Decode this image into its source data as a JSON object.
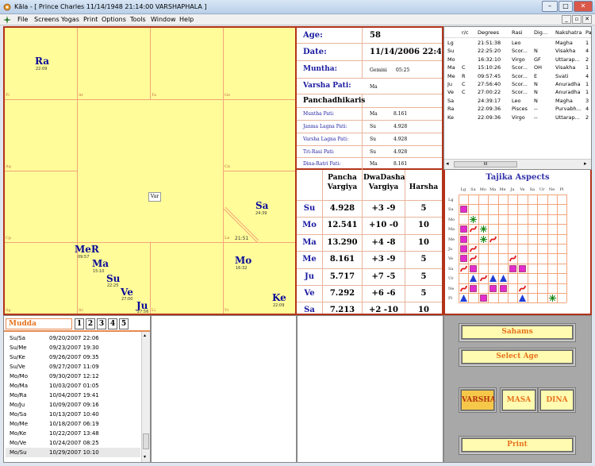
{
  "window": {
    "title": "Kāla - [ Prince Charles  11/14/1948  21:14:00      VARSHAPHALA ]",
    "min": "–",
    "max": "□",
    "close": "✕"
  },
  "menu": [
    "File",
    "Screens",
    "Yogas",
    "Print",
    "Options",
    "Tools",
    "Window",
    "Help"
  ],
  "mdi": {
    "min": "_",
    "restore": "▫",
    "close": "✕"
  },
  "chart": {
    "grid_labels": [
      "Pi",
      "Ar",
      "Ta",
      "Ge",
      "Aq",
      "Cn",
      "Cp",
      "Le",
      "Sg",
      "Sc",
      "Li",
      "Vi"
    ],
    "lagna_time": "21:51",
    "center_label": "Var",
    "planets": [
      {
        "name": "Ra",
        "time": "22:09"
      },
      {
        "name": "Sa",
        "time": "24:39"
      },
      {
        "name": "MeR",
        "time": "09:57"
      },
      {
        "name": "Ma",
        "time": "15:10"
      },
      {
        "name": "Su",
        "time": "22:25"
      },
      {
        "name": "Ve",
        "time": "27:00"
      },
      {
        "name": "Ju",
        "time": "27:56"
      },
      {
        "name": "Mo",
        "time": "16:32"
      },
      {
        "name": "Ke",
        "time": "22:09"
      }
    ]
  },
  "info": {
    "age_label": "Age:",
    "age": "58",
    "date_label": "Date:",
    "date": "11/14/2006  22:47:29",
    "muntha_label": "Muntha:",
    "muntha_sign": "Gemini",
    "muntha_deg": "05:25",
    "varsha_pati_label": "Varsha Pati:",
    "varsha_pati": "Ma",
    "panchadhikaris_label": "Panchadhikaris",
    "rows": [
      {
        "label": "Muntha Pati:",
        "planet": "Ma",
        "value": "8.161"
      },
      {
        "label": "Janma Lagna Pati:",
        "planet": "Su",
        "value": "4.928"
      },
      {
        "label": "Varsha Lagna Pati:",
        "planet": "Su",
        "value": "4.928"
      },
      {
        "label": "Tri-Rasi Pati:",
        "planet": "Su",
        "value": "4.928"
      },
      {
        "label": "Dina-Ratri Pati:",
        "planet": "Ma",
        "value": "8.161"
      }
    ]
  },
  "vargiya": {
    "headers": [
      "Pancha Vargiya",
      "DwaDasha Vargiya",
      "Harsha"
    ],
    "rows": [
      {
        "p": "Su",
        "pancha": "4.928",
        "dwa": "+3  -9",
        "harsha": "5"
      },
      {
        "p": "Mo",
        "pancha": "12.541",
        "dwa": "+10  -0",
        "harsha": "10"
      },
      {
        "p": "Ma",
        "pancha": "13.290",
        "dwa": "+4  -8",
        "harsha": "10"
      },
      {
        "p": "Me",
        "pancha": "8.161",
        "dwa": "+3  -9",
        "harsha": "5"
      },
      {
        "p": "Ju",
        "pancha": "5.717",
        "dwa": "+7  -5",
        "harsha": "5"
      },
      {
        "p": "Ve",
        "pancha": "7.292",
        "dwa": "+6  -6",
        "harsha": "5"
      },
      {
        "p": "Sa",
        "pancha": "7.213",
        "dwa": "+2  -10",
        "harsha": "10"
      }
    ]
  },
  "positions": {
    "headers": [
      "",
      "r/c",
      "Degrees",
      "Rasi",
      "Dig...",
      "Nakshatra",
      "Pa"
    ],
    "rows": [
      [
        "Lg",
        "",
        "21:51:38",
        "Leo",
        "",
        "Magha",
        "1"
      ],
      [
        "Su",
        "",
        "22:25:20",
        "Scor...",
        "N",
        "Visakha",
        "4"
      ],
      [
        "Mo",
        "",
        "16:32:10",
        "Virgo",
        "GF",
        "Uttarap...",
        "2"
      ],
      [
        "Ma",
        "C",
        "15:10:26",
        "Scor...",
        "OH",
        "Visakha",
        "1"
      ],
      [
        "Me",
        "R",
        "09:57:45",
        "Scor...",
        "E",
        "Svati",
        "4"
      ],
      [
        "Ju",
        "C",
        "27:56:40",
        "Scor...",
        "N",
        "Anuradha",
        "1"
      ],
      [
        "Ve",
        "C",
        "27:00:22",
        "Scor...",
        "N",
        "Anuradha",
        "1"
      ],
      [
        "Sa",
        "",
        "24:39:17",
        "Leo",
        "N",
        "Magha",
        "3"
      ],
      [
        "Ra",
        "",
        "22:09:36",
        "Pisces",
        "--",
        "Purvabh...",
        "4"
      ],
      [
        "Ke",
        "",
        "22:09:36",
        "Virgo",
        "--",
        "Uttarap...",
        "2"
      ]
    ],
    "scroll_grip": "III"
  },
  "tajika": {
    "title": "Tajika Aspects",
    "cols": [
      "Lg",
      "Su",
      "Mo",
      "Ma",
      "Me",
      "Ju",
      "Ve",
      "Sa",
      "Ur",
      "Ne",
      "Pl"
    ],
    "rows": [
      "Lg",
      "Su",
      "Mo",
      "Ma",
      "Me",
      "Ju",
      "Ve",
      "Sa",
      "Ur",
      "Ne",
      "Pl"
    ],
    "colors": {
      "square": "#e22bd0",
      "triangle": "#1f3ed6",
      "curve": "#e01818",
      "star": "#1a8a1a"
    },
    "marks": [
      {
        "r": 1,
        "c": 0,
        "t": "square"
      },
      {
        "r": 2,
        "c": 1,
        "t": "star"
      },
      {
        "r": 3,
        "c": 0,
        "t": "square"
      },
      {
        "r": 3,
        "c": 1,
        "t": "curve"
      },
      {
        "r": 3,
        "c": 2,
        "t": "star"
      },
      {
        "r": 4,
        "c": 0,
        "t": "square"
      },
      {
        "r": 4,
        "c": 2,
        "t": "star"
      },
      {
        "r": 4,
        "c": 3,
        "t": "curve"
      },
      {
        "r": 5,
        "c": 0,
        "t": "square"
      },
      {
        "r": 5,
        "c": 1,
        "t": "curve"
      },
      {
        "r": 6,
        "c": 0,
        "t": "square"
      },
      {
        "r": 6,
        "c": 1,
        "t": "curve"
      },
      {
        "r": 6,
        "c": 5,
        "t": "curve"
      },
      {
        "r": 7,
        "c": 0,
        "t": "curve"
      },
      {
        "r": 7,
        "c": 1,
        "t": "square"
      },
      {
        "r": 7,
        "c": 5,
        "t": "square"
      },
      {
        "r": 7,
        "c": 6,
        "t": "square"
      },
      {
        "r": 8,
        "c": 1,
        "t": "triangle"
      },
      {
        "r": 8,
        "c": 2,
        "t": "curve"
      },
      {
        "r": 8,
        "c": 3,
        "t": "triangle"
      },
      {
        "r": 8,
        "c": 4,
        "t": "triangle"
      },
      {
        "r": 9,
        "c": 0,
        "t": "curve"
      },
      {
        "r": 9,
        "c": 1,
        "t": "square"
      },
      {
        "r": 9,
        "c": 3,
        "t": "square"
      },
      {
        "r": 9,
        "c": 4,
        "t": "square"
      },
      {
        "r": 9,
        "c": 6,
        "t": "curve"
      },
      {
        "r": 10,
        "c": 0,
        "t": "triangle"
      },
      {
        "r": 10,
        "c": 2,
        "t": "square"
      },
      {
        "r": 10,
        "c": 6,
        "t": "triangle"
      },
      {
        "r": 10,
        "c": 9,
        "t": "star"
      }
    ]
  },
  "mudda": {
    "label": "Mudda",
    "tabs": [
      "1",
      "2",
      "3",
      "4",
      "5"
    ],
    "rows": [
      [
        "Su/Sa",
        "09/20/2007  22:06"
      ],
      [
        "Su/Me",
        "09/23/2007  19:30"
      ],
      [
        "Su/Ke",
        "09/26/2007  09:35"
      ],
      [
        "Su/Ve",
        "09/27/2007  11:09"
      ],
      [
        "Mo/Mo",
        "09/30/2007  12:12"
      ],
      [
        "Mo/Ma",
        "10/03/2007  01:05"
      ],
      [
        "Mo/Ra",
        "10/04/2007  19:41"
      ],
      [
        "Mo/Ju",
        "10/09/2007  09:16"
      ],
      [
        "Mo/Sa",
        "10/13/2007  10:40"
      ],
      [
        "Mo/Me",
        "10/18/2007  06:19"
      ],
      [
        "Mo/Ke",
        "10/22/2007  13:48"
      ],
      [
        "Mo/Ve",
        "10/24/2007  08:25"
      ],
      [
        "Mo/Su",
        "10/29/2007  10:10"
      ]
    ]
  },
  "buttons": {
    "sahams": "Sahams",
    "select_age": "Select Age",
    "varsha": "VARSHA",
    "masa": "MASA",
    "dina": "DINA",
    "print": "Print"
  }
}
